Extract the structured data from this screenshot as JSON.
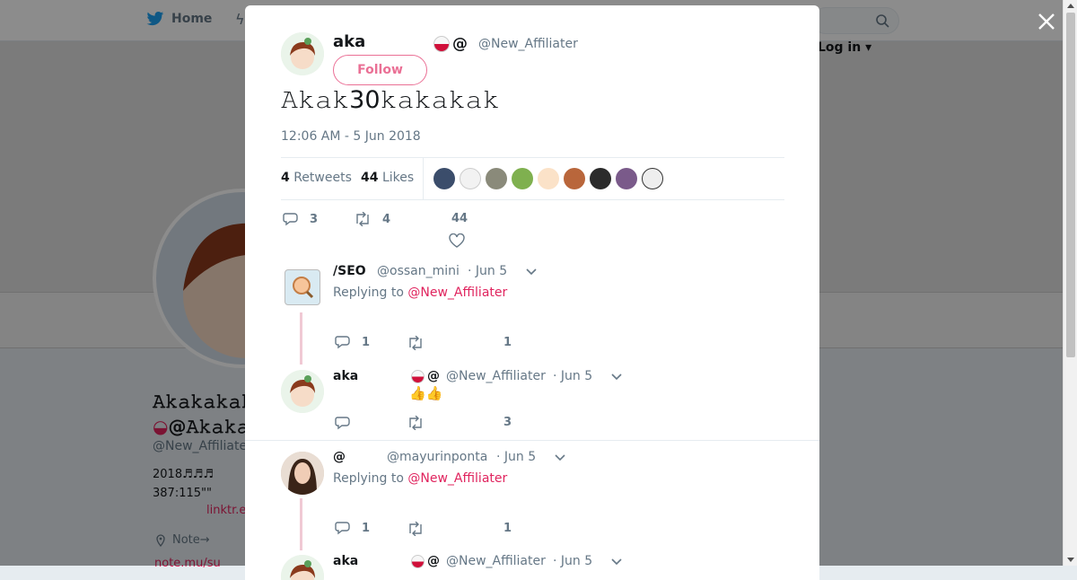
{
  "background": {
    "nav_home": "Home",
    "nav_login": "Log in",
    "profile_name_line1": "𝙰𝚔𝚊𝚔𝚊𝚔𝚊𝚔𝚊𝚔𝚊𝚔",
    "profile_name_line2": "@𝙰𝚔𝚊𝚔𝚊",
    "profile_handle": "@New_Affiliater",
    "bio_line1": "2018♬♬♬",
    "bio_line2": "387:115\"\"",
    "bio_link": "linktr.ee",
    "location": "Note→",
    "website": "note.mu/su"
  },
  "tweet": {
    "author_name": "aka",
    "author_emoji_at": "@",
    "author_handle": "@New_Affiliater",
    "follow_label": "Follow",
    "text": "𝙰𝚔𝚊𝚔30𝚔𝚊𝚔𝚊𝚔𝚊𝚔",
    "timestamp": "12:06 AM - 5 Jun 2018",
    "retweets_count": "4",
    "retweets_label": "Retweets",
    "likes_count": "44",
    "likes_label": "Likes",
    "reply_count": "3",
    "retweet_count": "4",
    "like_count": "44"
  },
  "replies": [
    {
      "name": "/SEO",
      "handle": "@ossan_mini",
      "date": "· Jun 5",
      "replying_prefix": "Replying to",
      "replying_to": "@New_Affiliater",
      "reply_count": "1",
      "like_count": "1"
    },
    {
      "name": "aka",
      "emoji_at": "@",
      "handle": "@New_Affiliater",
      "date": "· Jun 5",
      "text": "👍👍",
      "like_count": "3"
    },
    {
      "name": "@",
      "handle": "@mayurinponta",
      "date": "· Jun 5",
      "replying_prefix": "Replying to",
      "replying_to": "@New_Affiliater",
      "reply_count": "1",
      "like_count": "1"
    },
    {
      "name": "aka",
      "emoji_at": "@",
      "handle": "@New_Affiliater",
      "date": "· Jun 5"
    }
  ],
  "colors": {
    "accent": "#e0245e",
    "muted": "#657786",
    "text": "#14171a"
  }
}
